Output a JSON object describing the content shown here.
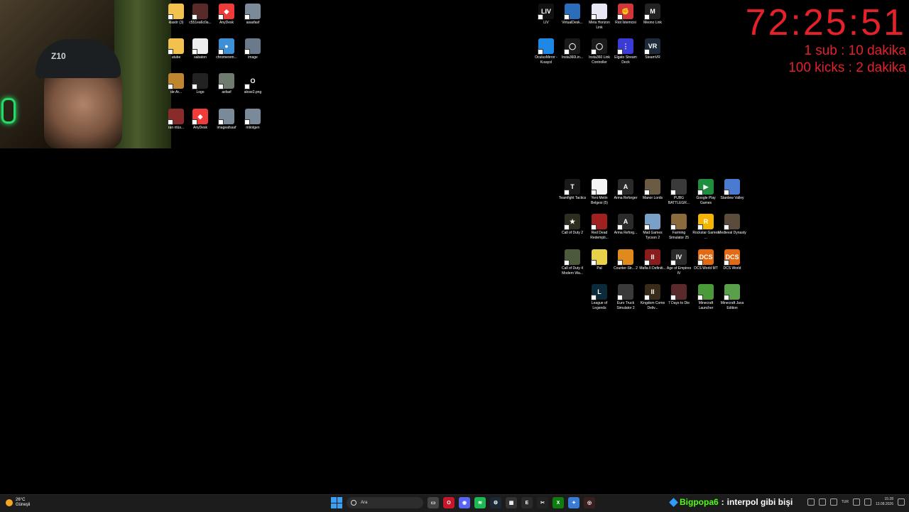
{
  "overlay": {
    "timer": "72:25:51",
    "goal_sub": "1 sub : 10 dakika",
    "goal_kicks": "100 kicks : 2 dakika"
  },
  "webcam": {
    "cap_text": "Z10"
  },
  "left_icons": [
    {
      "label": "klasör (3)",
      "color": "#f2c14e",
      "glyph": ""
    },
    {
      "label": "c551ea6c0a...",
      "color": "#5a2a2a",
      "glyph": ""
    },
    {
      "label": "AnyDesk",
      "color": "#ef3b39",
      "glyph": "◆"
    },
    {
      "label": "asasfasf",
      "color": "#7a8a99",
      "glyph": ""
    },
    {
      "label": "utube",
      "color": "#f2c14e",
      "glyph": ""
    },
    {
      "label": "sabaton",
      "color": "#eeeeee",
      "glyph": ""
    },
    {
      "label": "chromerem...",
      "color": "#3d8fd6",
      "glyph": "●"
    },
    {
      "label": "image",
      "color": "#6b7a8a",
      "glyph": ""
    },
    {
      "label": "de-Ar...",
      "color": "#c0852f",
      "glyph": ""
    },
    {
      "label": "Logo",
      "color": "#222222",
      "glyph": ""
    },
    {
      "label": "asfasf",
      "color": "#6e7b6e",
      "glyph": ""
    },
    {
      "label": "alose2.png",
      "color": "#000000",
      "glyph": "O"
    },
    {
      "label": "ran ntüs...",
      "color": "#8a2b2b",
      "glyph": ""
    },
    {
      "label": "AnyDesk",
      "color": "#ef3b39",
      "glyph": "◆"
    },
    {
      "label": "imageafsasf",
      "color": "#7a8a99",
      "glyph": ""
    },
    {
      "label": "mtiotgen",
      "color": "#7a8a99",
      "glyph": ""
    }
  ],
  "top_right_icons": [
    {
      "label": "LIV",
      "color": "#111111",
      "glyph": "LIV"
    },
    {
      "label": "VirtualDesk...",
      "color": "#2a6ebb",
      "glyph": ""
    },
    {
      "label": "Meta Horizon Link",
      "color": "#e8e8f5",
      "glyph": ""
    },
    {
      "label": "Riot İstemcisi",
      "color": "#d13639",
      "glyph": "✊"
    },
    {
      "label": "Meono Link",
      "color": "#222222",
      "glyph": "M"
    },
    {
      "label": "OculusMirror - Kısayol",
      "color": "#1e88e5",
      "glyph": ""
    },
    {
      "label": "Insta360Lin...",
      "color": "#1a1a1a",
      "glyph": "◯"
    },
    {
      "label": "Insta360 Link Controller",
      "color": "#1a1a1a",
      "glyph": "◯"
    },
    {
      "label": "Elgato Stream Deck",
      "color": "#3b3bd6",
      "glyph": "⋮"
    },
    {
      "label": "SteamVR",
      "color": "#1c2a3a",
      "glyph": "VR"
    }
  ],
  "game_icons": [
    {
      "label": "Teamfight Tactics",
      "color": "#1a1a1a",
      "glyph": "T"
    },
    {
      "label": "Yeni Metin Belgesi (5)",
      "color": "#f4f4f4",
      "glyph": ""
    },
    {
      "label": "Arma Reforger",
      "color": "#2b2b2b",
      "glyph": "A"
    },
    {
      "label": "Manor Lords",
      "color": "#6b5b45",
      "glyph": ""
    },
    {
      "label": "PUBG BATTLEGR...",
      "color": "#3a3a3a",
      "glyph": ""
    },
    {
      "label": "Google Play Games",
      "color": "#1f8f3f",
      "glyph": "▶"
    },
    {
      "label": "Stardew Valley",
      "color": "#4a7bd0",
      "glyph": ""
    },
    {
      "label": "Call of Duty 2",
      "color": "#2e2e20",
      "glyph": "★"
    },
    {
      "label": "Red Dead Redempti...",
      "color": "#a12020",
      "glyph": ""
    },
    {
      "label": "Arma Reforg...",
      "color": "#2b2b2b",
      "glyph": "A"
    },
    {
      "label": "Mad Games Tycoon 2",
      "color": "#7aa0c8",
      "glyph": ""
    },
    {
      "label": "Farming Simulator 25",
      "color": "#8b6b3b",
      "glyph": ""
    },
    {
      "label": "Rockstar Games ...",
      "color": "#f5b400",
      "glyph": "R"
    },
    {
      "label": "Medieval Dynasty",
      "color": "#5b4b3b",
      "glyph": ""
    },
    {
      "label": "Call of Duty 4 Modern Wa...",
      "color": "#4a5a3a",
      "glyph": ""
    },
    {
      "label": "Pal",
      "color": "#e8d24a",
      "glyph": ""
    },
    {
      "label": "Counter-Str... 2",
      "color": "#e08a1e",
      "glyph": ""
    },
    {
      "label": "Mafia II Definiti...",
      "color": "#8a1c1c",
      "glyph": "II"
    },
    {
      "label": "Age of Empires IV",
      "color": "#2a2a2a",
      "glyph": "IV"
    },
    {
      "label": "DCS World MT",
      "color": "#e36a12",
      "glyph": "DCS"
    },
    {
      "label": "DCS World",
      "color": "#e36a12",
      "glyph": "DCS"
    },
    {
      "label": "League of Legends",
      "color": "#0b2a3a",
      "glyph": "L"
    },
    {
      "label": "Euro Truck Simulator 2",
      "color": "#3a3a3a",
      "glyph": ""
    },
    {
      "label": "Kingdom Come Deliv...",
      "color": "#3a2a1a",
      "glyph": "II"
    },
    {
      "label": "7 Days to Die",
      "color": "#5a2a2a",
      "glyph": ""
    },
    {
      "label": "Minecraft Launcher",
      "color": "#4a9a3a",
      "glyph": ""
    },
    {
      "label": "Minecraft Java Edition",
      "color": "#5aa04a",
      "glyph": ""
    }
  ],
  "taskbar": {
    "weather_temp": "26°C",
    "weather_desc": "Güneşli",
    "search_placeholder": "Ara",
    "apps": [
      {
        "name": "task-view",
        "color": "#444444",
        "glyph": "▭"
      },
      {
        "name": "opera-gx",
        "color": "#c6172c",
        "glyph": "O"
      },
      {
        "name": "discord",
        "color": "#5865f2",
        "glyph": "◉"
      },
      {
        "name": "spotify",
        "color": "#1db954",
        "glyph": "≋"
      },
      {
        "name": "steam",
        "color": "#1b2838",
        "glyph": "⚙"
      },
      {
        "name": "capture",
        "color": "#333333",
        "glyph": "▦"
      },
      {
        "name": "epic",
        "color": "#2a2a2a",
        "glyph": "E"
      },
      {
        "name": "capcut",
        "color": "#222222",
        "glyph": "✂"
      },
      {
        "name": "xbox",
        "color": "#107c10",
        "glyph": "X"
      },
      {
        "name": "copilot",
        "color": "#3a7bd5",
        "glyph": "✦"
      },
      {
        "name": "obs",
        "color": "#3a1f1f",
        "glyph": "◎"
      }
    ],
    "chat_user": "Bigpopa6",
    "chat_sep": ":",
    "chat_msg": "interpol gibi bişi",
    "lang": "TUR",
    "time": "15:28",
    "date": "13.08.2026"
  }
}
